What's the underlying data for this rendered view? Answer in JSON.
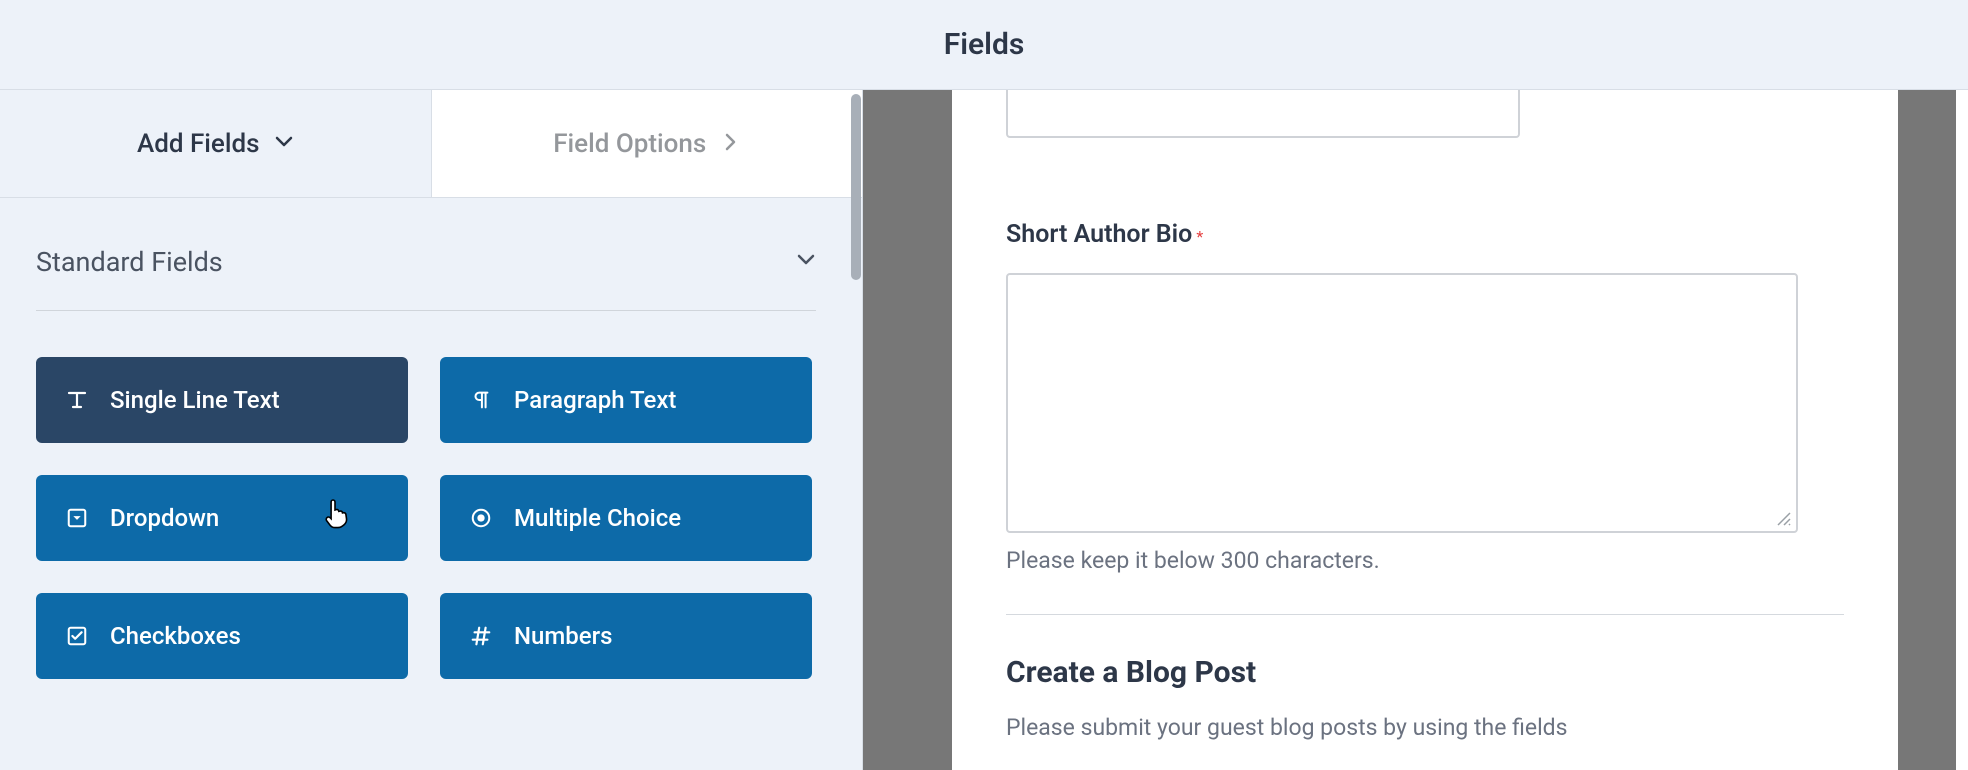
{
  "header": {
    "title": "Fields"
  },
  "tabs": {
    "add": "Add Fields",
    "options": "Field Options"
  },
  "section": {
    "title": "Standard Fields"
  },
  "cards": {
    "single_line": "Single Line Text",
    "paragraph": "Paragraph Text",
    "dropdown": "Dropdown",
    "multiple_choice": "Multiple Choice",
    "checkboxes": "Checkboxes",
    "numbers": "Numbers"
  },
  "preview": {
    "bio_label": "Short Author Bio",
    "bio_helper": "Please keep it below 300 characters.",
    "post_title": "Create a Blog Post",
    "post_desc": "Please submit your guest blog posts by using the fields"
  }
}
